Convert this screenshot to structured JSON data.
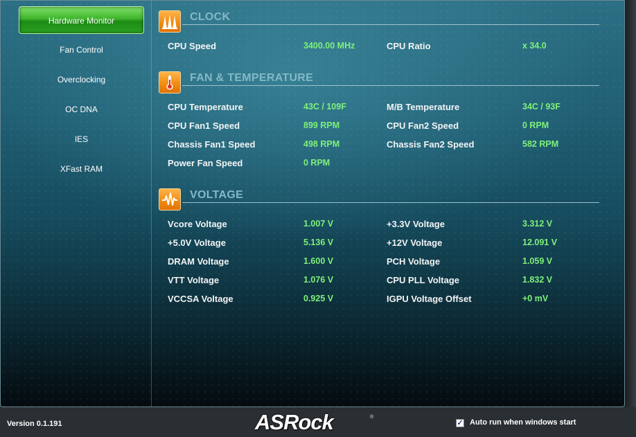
{
  "sidebar": {
    "items": [
      {
        "label": "Hardware Monitor",
        "active": true
      },
      {
        "label": "Fan Control",
        "active": false
      },
      {
        "label": "Overclocking",
        "active": false
      },
      {
        "label": "OC DNA",
        "active": false
      },
      {
        "label": "IES",
        "active": false
      },
      {
        "label": "XFast RAM",
        "active": false
      }
    ]
  },
  "sections": {
    "clock": {
      "title": "CLOCK",
      "icon": "clock-bars-icon",
      "rows": [
        {
          "left_label": "CPU Speed",
          "left_value": "3400.00 MHz",
          "right_label": "CPU Ratio",
          "right_value": "x 34.0"
        }
      ]
    },
    "fan_temp": {
      "title": "FAN & TEMPERATURE",
      "icon": "thermometer-icon",
      "rows": [
        {
          "left_label": "CPU Temperature",
          "left_value": "43C / 109F",
          "right_label": "M/B Temperature",
          "right_value": "34C / 93F"
        },
        {
          "left_label": "CPU Fan1 Speed",
          "left_value": "899 RPM",
          "right_label": "CPU Fan2 Speed",
          "right_value": "0 RPM"
        },
        {
          "left_label": "Chassis Fan1 Speed",
          "left_value": "498 RPM",
          "right_label": "Chassis Fan2 Speed",
          "right_value": "582 RPM"
        },
        {
          "left_label": "Power Fan Speed",
          "left_value": "0 RPM"
        }
      ]
    },
    "voltage": {
      "title": "VOLTAGE",
      "icon": "waveform-icon",
      "rows": [
        {
          "left_label": "Vcore Voltage",
          "left_value": "1.007 V",
          "right_label": "+3.3V Voltage",
          "right_value": "3.312 V"
        },
        {
          "left_label": "+5.0V Voltage",
          "left_value": "5.136 V",
          "right_label": "+12V Voltage",
          "right_value": "12.091 V"
        },
        {
          "left_label": "DRAM Voltage",
          "left_value": "1.600 V",
          "right_label": "PCH Voltage",
          "right_value": "1.059 V"
        },
        {
          "left_label": "VTT Voltage",
          "left_value": "1.076 V",
          "right_label": "CPU PLL Voltage",
          "right_value": "1.832 V"
        },
        {
          "left_label": "VCCSA Voltage",
          "left_value": "0.925 V",
          "right_label": "IGPU Voltage Offset",
          "right_value": "+0 mV"
        }
      ]
    }
  },
  "footer": {
    "version": "Version  0.1.191",
    "logo_text": "ASRock",
    "logo_mark": "®",
    "autorun_label": "Auto run when windows start",
    "autorun_checked": true,
    "checkmark": "✓"
  },
  "colors": {
    "value_green": "#7ff07a",
    "active_tab_green": "#3fb42c",
    "section_icon_orange": "#f08a10",
    "section_title": "#84b9c8"
  }
}
